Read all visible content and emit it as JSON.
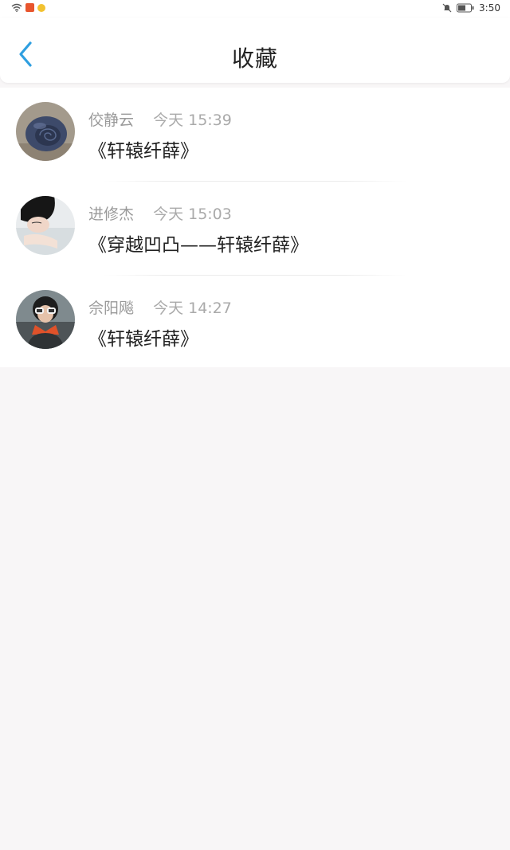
{
  "status_bar": {
    "time": "3:50",
    "icons": [
      "wifi-icon",
      "app-notification-icon",
      "weather-icon",
      "mute-icon",
      "battery-icon"
    ]
  },
  "header": {
    "title": "收藏",
    "back_icon": "chevron-left-icon",
    "accent_color": "#2f9fe0"
  },
  "favorites": [
    {
      "user": "佼静云",
      "time": "今天 15:39",
      "work": "《轩辕纤薛》",
      "avatar": "snail-shell-photo"
    },
    {
      "user": "进修杰",
      "time": "今天 15:03",
      "work": "《穿越凹凸——轩辕纤薛》",
      "avatar": "girl-lying-photo"
    },
    {
      "user": "佘阳飚",
      "time": "今天 14:27",
      "work": "《轩辕纤薛》",
      "avatar": "girl-sunglasses-photo"
    }
  ]
}
